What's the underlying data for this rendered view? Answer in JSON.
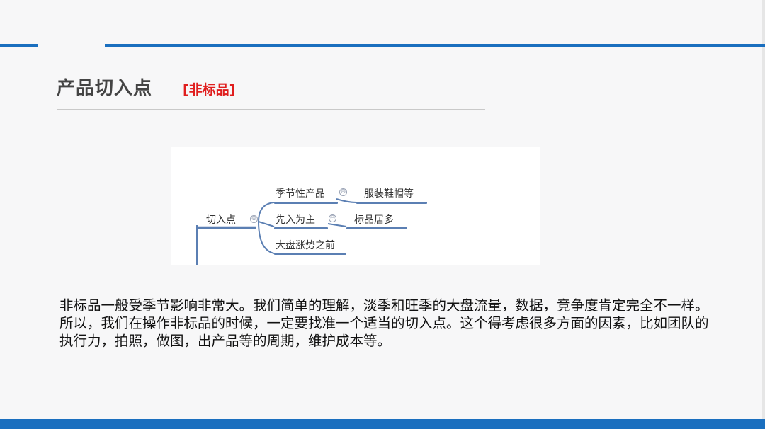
{
  "slide": {
    "title": "产品切入点",
    "tag": "[非标品]",
    "paragraph": "非标品一般受季节影响非常大。我们简单的理解，淡季和旺季的大盘流量，数据，竞争度肯定完全不一样。所以，我们在操作非标品的时候，一定要找准一个适当的切入点。这个得考虑很多方面的因素，比如团队的执行力，拍照，做图，出产品等的周期，维护成本等。"
  },
  "mindmap": {
    "root": "切入点",
    "branches": [
      {
        "label": "季节性产品",
        "child": "服装鞋帽等"
      },
      {
        "label": "先入为主",
        "child": "标品居多"
      },
      {
        "label": "大盘涨势之前"
      }
    ],
    "collapse_symbol": "⊖"
  }
}
